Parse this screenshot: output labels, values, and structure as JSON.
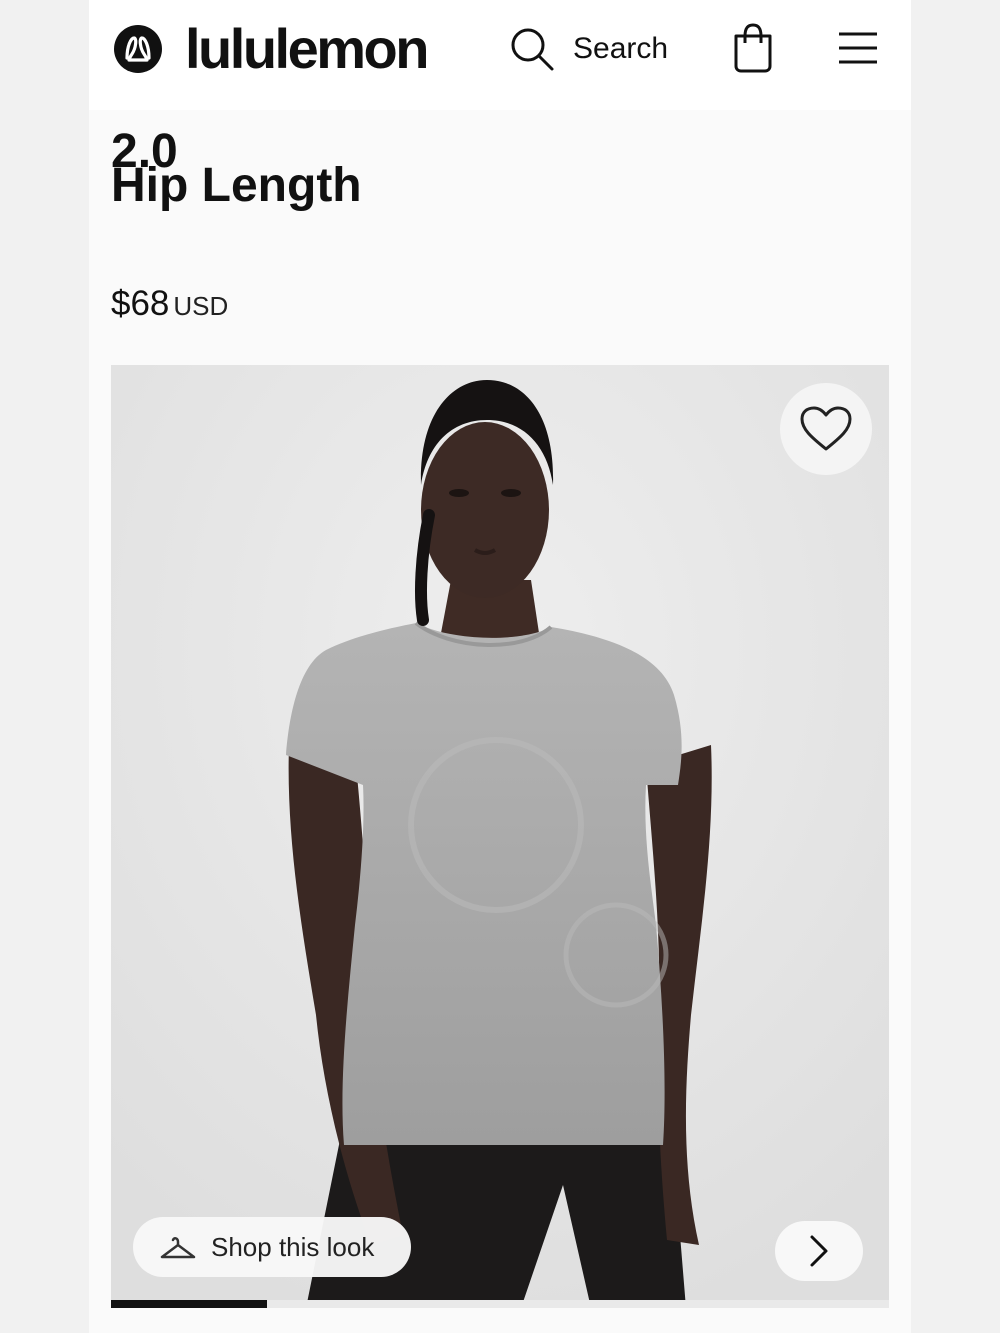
{
  "header": {
    "brand": "lululemon",
    "search_label": "Search"
  },
  "icons": {
    "logo": "lululemon-logo-icon",
    "search": "search-icon",
    "bag": "shopping-bag-icon",
    "menu": "hamburger-menu-icon",
    "wishlist": "heart-icon",
    "hanger": "hanger-icon",
    "next": "chevron-right-icon"
  },
  "product": {
    "title_line1": "2.0",
    "title_line2": "Hip Length",
    "price": "$68",
    "currency": "USD"
  },
  "gallery": {
    "shop_look_label": "Shop this look",
    "progress_fraction": 0.2
  },
  "colors": {
    "text": "#111111",
    "image_background": "#e4e4e4",
    "shirt": "#a9a9a9"
  }
}
